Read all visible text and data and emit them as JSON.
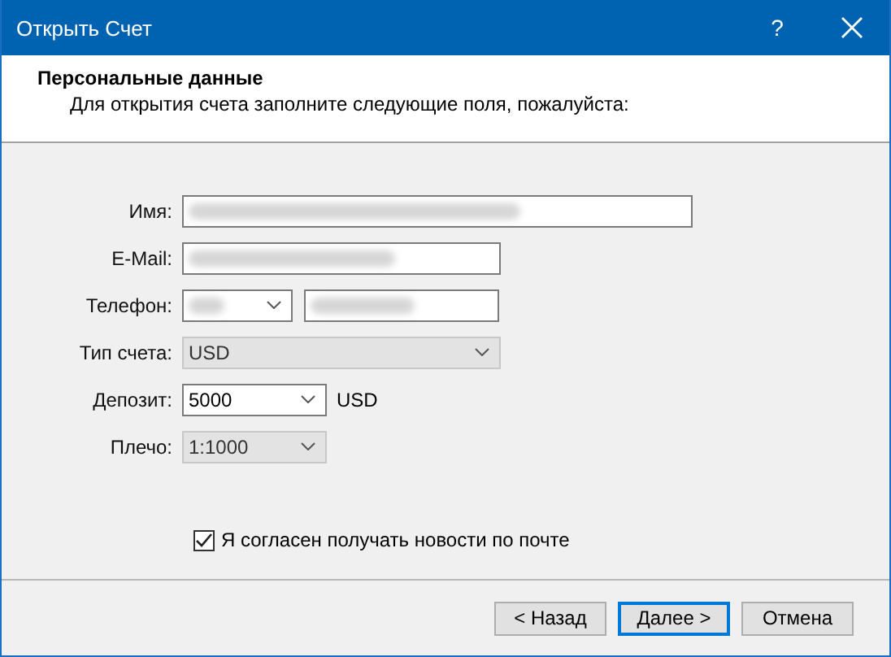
{
  "window": {
    "title": "Открыть Счет",
    "help": "?"
  },
  "header": {
    "title": "Персональные данные",
    "subtitle": "Для открытия счета заполните следующие поля, пожалуйста:"
  },
  "fields": [
    {
      "kind": "text",
      "label": "Имя:",
      "redacted": true
    },
    {
      "kind": "text",
      "label": "E-Mail:",
      "redacted": true
    },
    {
      "kind": "phone",
      "label": "Телефон:",
      "redacted": true
    },
    {
      "kind": "combo",
      "label": "Тип счета:",
      "value": "USD",
      "disabled": true
    },
    {
      "kind": "combo",
      "label": "Депозит:",
      "value": "5000",
      "disabled": false,
      "suffix": "USD"
    },
    {
      "kind": "combo",
      "label": "Плечо:",
      "value": "1:1000",
      "disabled": true
    }
  ],
  "newsletter": {
    "label": "Я согласен получать новости по почте",
    "checked": true
  },
  "buttons": [
    {
      "label": "< Назад",
      "default": false
    },
    {
      "label": "Далее >",
      "default": true
    },
    {
      "label": "Отмена",
      "default": false
    }
  ]
}
